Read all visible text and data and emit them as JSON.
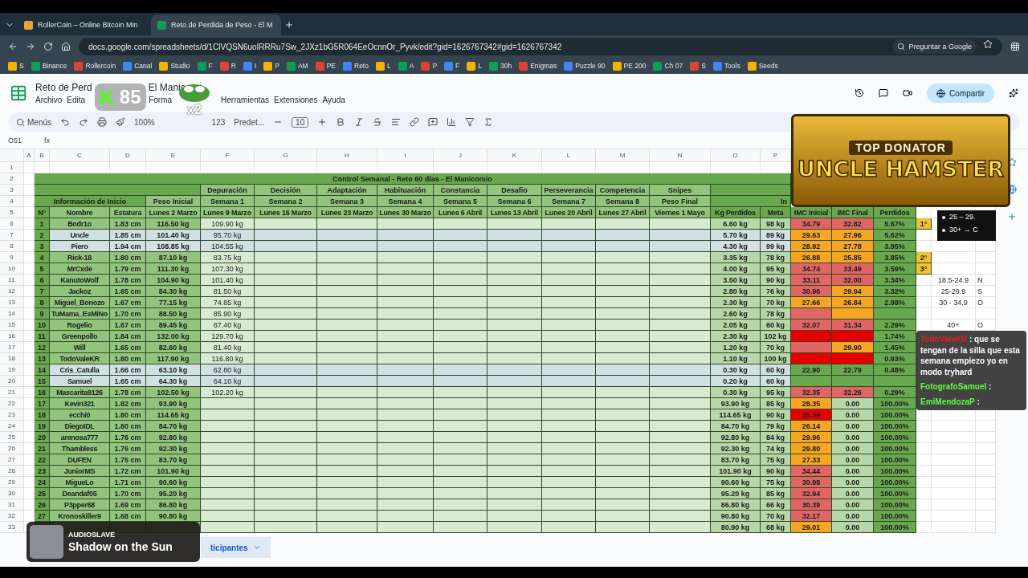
{
  "browser": {
    "tabs": [
      {
        "label": "RollerCoin – Online Bitcoin Min",
        "selected": false
      },
      {
        "label": "Reto de Perdida de Peso - El M",
        "selected": true
      }
    ],
    "url": "docs.google.com/spreadsheets/d/1ClVQSN6uoIRRRu7Sw_2JXz1bG5R064EeOcnnOr_Pyvk/edit?gid=1626767342#gid=1626767342",
    "ask_button": "Preguntar a Google",
    "bookmarks": [
      "S",
      "Binance",
      "Rollercoin",
      "Canal",
      "Studio",
      "F",
      "R",
      "I",
      "P",
      "AM",
      "PE",
      "Reto",
      "L",
      "A",
      "P",
      "F",
      "L",
      "30h",
      "Enigmas",
      "Puzzle 90",
      "PE 200",
      "Ch 07",
      "S",
      "Tools",
      "Seeds"
    ]
  },
  "sheets": {
    "title": "Reto de Perd",
    "title_tail": "El Manic",
    "menus": [
      "Archivo",
      "Edita",
      "Forma",
      "Herramientas",
      "Extensiones",
      "Ayuda"
    ],
    "share_button": "Compartir",
    "search_menus": "Menús",
    "zoom": "100%",
    "number_format": "123",
    "font": "Predet...",
    "font_size": "10",
    "cell_ref": "O51",
    "formula_label": "fx"
  },
  "row_numbers": [
    "1",
    "2",
    "3",
    "4",
    "5",
    "6",
    "7",
    "8",
    "9",
    "10",
    "11",
    "12",
    "13",
    "14",
    "15",
    "16",
    "17",
    "18",
    "19",
    "20",
    "21",
    "22",
    "23",
    "24",
    "25",
    "26",
    "27",
    "28",
    "29",
    "30",
    "31",
    "32",
    "33"
  ],
  "column_letters": [
    "A",
    "B",
    "C",
    "D",
    "E",
    "F",
    "G",
    "H",
    "I",
    "J",
    "K",
    "L",
    "M",
    "N",
    "O",
    "P"
  ],
  "table_title": "Control Semanal - Reto 60 días - El Manicomio",
  "stages": [
    "Depuración",
    "Decisión",
    "Adaptación",
    "Habituación",
    "Constancia",
    "Desafio",
    "Perseverancia",
    "Competencia",
    "Snipes"
  ],
  "group_start": "Información de Inicio",
  "peso_inicial": "Peso Inicial",
  "weeks": [
    "Semana 1",
    "Semana 2",
    "Semana 3",
    "Semana 4",
    "Semana 5",
    "Semana 6",
    "Semana 7",
    "Semana 8",
    "Peso Final"
  ],
  "group_end": "In",
  "columns": [
    "N°",
    "Nombre",
    "Estatura",
    "Lunes 2 Marzo",
    "Lunes 9 Marzo",
    "Lunes 16 Marzo",
    "Lunes 23 Marzo",
    "Lunes 30 Marzo",
    "Lunes 6 Abril",
    "Lunes 13 Abril",
    "Lunes 20 Abril",
    "Lunes 27 Abril",
    "Viernes 1 Mayo",
    "Kg Perdidos",
    "Meta",
    "IMC Inicial",
    "IMC Final",
    "Perdidos"
  ],
  "rows": [
    {
      "n": "1",
      "name": "Bodr1o",
      "height": "1.83 cm",
      "start": "116.50 kg",
      "week1": "109.90 kg",
      "lost": "6.60 kg",
      "goal": "98 kg",
      "imc_start": {
        "value": "34.79",
        "color": "#e06666"
      },
      "imc_end": {
        "value": "32.82",
        "color": "#e06666"
      },
      "percent": "5.67%",
      "rank": "1°",
      "highlighted": false
    },
    {
      "n": "2",
      "name": "Uncle",
      "height": "1.85 cm",
      "start": "101.40 kg",
      "week1": "95.70 kg",
      "lost": "5.70 kg",
      "goal": "89 kg",
      "imc_start": {
        "value": "29.63",
        "color": "#f6a623"
      },
      "imc_end": {
        "value": "27.96",
        "color": "#f6a623"
      },
      "percent": "5.62%",
      "highlighted": true
    },
    {
      "n": "3",
      "name": "Piero",
      "height": "1.94 cm",
      "start": "108.85 kg",
      "week1": "104.55 kg",
      "lost": "4.30 kg",
      "goal": "99 kg",
      "imc_start": {
        "value": "28.92",
        "color": "#f6a623"
      },
      "imc_end": {
        "value": "27.78",
        "color": "#f6a623"
      },
      "percent": "3.95%",
      "highlighted": true
    },
    {
      "n": "4",
      "name": "Rick-18",
      "height": "1.80 cm",
      "start": "87.10 kg",
      "week1": "83.75 kg",
      "lost": "3.35 kg",
      "goal": "78 kg",
      "imc_start": {
        "value": "26.88",
        "color": "#f6a623"
      },
      "imc_end": {
        "value": "25.85",
        "color": "#f6a623"
      },
      "percent": "3.85%",
      "rank": "2°",
      "highlighted": false
    },
    {
      "n": "5",
      "name": "MrCxde",
      "height": "1.79 cm",
      "start": "111.30 kg",
      "week1": "107.30 kg",
      "lost": "4.00 kg",
      "goal": "95 kg",
      "imc_start": {
        "value": "34.74",
        "color": "#e06666"
      },
      "imc_end": {
        "value": "33.49",
        "color": "#e06666"
      },
      "percent": "3.59%",
      "rank": "3°",
      "highlighted": false
    },
    {
      "n": "6",
      "name": "KanutoWolf",
      "height": "1.78 cm",
      "start": "104.90 kg",
      "week1": "101.40 kg",
      "lost": "3.50 kg",
      "goal": "90 kg",
      "imc_start": {
        "value": "33.11",
        "color": "#e06666"
      },
      "imc_end": {
        "value": "32.00",
        "color": "#e06666"
      },
      "percent": "3.34%",
      "side_range": "18.5-24.9",
      "side_label": "N",
      "highlighted": false
    },
    {
      "n": "7",
      "name": "Jackoz",
      "height": "1.65 cm",
      "start": "84.30 kg",
      "week1": "81.50 kg",
      "lost": "2.80 kg",
      "goal": "76 kg",
      "imc_start": {
        "value": "30.96",
        "color": "#e06666"
      },
      "imc_end": {
        "value": "29.94",
        "color": "#f6a623"
      },
      "percent": "3.32%",
      "side_range": "25-29.9",
      "side_label": "S",
      "highlighted": false
    },
    {
      "n": "8",
      "name": "Miguel_Bonozo",
      "height": "1.67 cm",
      "start": "77.15 kg",
      "week1": "74.85 kg",
      "lost": "2.30 kg",
      "goal": "70 kg",
      "imc_start": {
        "value": "27.66",
        "color": "#f6a623"
      },
      "imc_end": {
        "value": "26.84",
        "color": "#f6a623"
      },
      "percent": "2.98%",
      "side_range": "30 - 34.9",
      "side_label": "O",
      "highlighted": false
    },
    {
      "n": "9",
      "name": "TuMama_EsMiNo",
      "height": "1.70 cm",
      "start": "88.50 kg",
      "week1": "85.90 kg",
      "lost": "2.60 kg",
      "goal": "78 kg",
      "imc_start": {
        "color": "#e06666"
      },
      "imc_end": {
        "color": "#f6a623"
      },
      "highlighted": false
    },
    {
      "n": "10",
      "name": "Rogelio",
      "height": "1.67 cm",
      "start": "89.45 kg",
      "week1": "87.40 kg",
      "lost": "2.05 kg",
      "goal": "60 kg",
      "imc_start": {
        "value": "32.07",
        "color": "#e06666"
      },
      "imc_end": {
        "value": "31.34",
        "color": "#e06666"
      },
      "percent": "2.29%",
      "side_range": "40+",
      "side_label": "O",
      "highlighted": false
    },
    {
      "n": "11",
      "name": "Greenpollo",
      "height": "1.84 cm",
      "start": "132.00 kg",
      "week1": "129.70 kg",
      "lost": "2.30 kg",
      "goal": "102 kg",
      "imc_start": {
        "color": "#e60000"
      },
      "imc_end": {
        "color": "#e60000"
      },
      "percent": "1.74%",
      "highlighted": false
    },
    {
      "n": "12",
      "name": "Will",
      "height": "1.65 cm",
      "start": "82.60 kg",
      "week1": "81.40 kg",
      "lost": "1.20 kg",
      "goal": "70 kg",
      "imc_start": {
        "color": "#e06666"
      },
      "imc_end": {
        "value": "29.90",
        "color": "#f6a623"
      },
      "percent": "1.45%",
      "highlighted": false
    },
    {
      "n": "13",
      "name": "TodoValeKR",
      "height": "1.80 cm",
      "start": "117.90 kg",
      "week1": "116.80 kg",
      "lost": "1.10 kg",
      "goal": "100 kg",
      "imc_start": {
        "color": "#e60000"
      },
      "imc_end": {
        "color": "#e60000"
      },
      "percent": "0.93%",
      "highlighted": false
    },
    {
      "n": "14",
      "name": "Cris_Catulla",
      "height": "1.66 cm",
      "start": "63.10 kg",
      "week1": "62.80 kg",
      "lost": "0.30 kg",
      "goal": "60 kg",
      "imc_start": {
        "value": "22.90",
        "color": "#6aa84f"
      },
      "imc_end": {
        "value": "22.79",
        "color": "#6aa84f"
      },
      "percent": "0.48%",
      "highlighted": true
    },
    {
      "n": "15",
      "name": "Samuel",
      "height": "1.65 cm",
      "start": "64.30 kg",
      "week1": "64.10 kg",
      "lost": "0.20 kg",
      "goal": "60 kg",
      "imc_start": {
        "color": "#6aa84f"
      },
      "imc_end": {
        "color": "#6aa84f"
      },
      "highlighted": true
    },
    {
      "n": "16",
      "name": "Mascarita9126",
      "height": "1.78 cm",
      "start": "102.50 kg",
      "week1": "102.20 kg",
      "lost": "0.30 kg",
      "goal": "95 kg",
      "imc_start": {
        "value": "32.35",
        "color": "#e06666"
      },
      "imc_end": {
        "value": "32.26",
        "color": "#e06666"
      },
      "percent": "0.29%",
      "highlighted": false
    },
    {
      "n": "17",
      "name": "Kevin321",
      "height": "1.82 cm",
      "start": "93.90 kg",
      "lost": "93.90 kg",
      "goal": "85 kg",
      "imc_start": {
        "value": "28.35",
        "color": "#f6a623"
      },
      "imc_end": {
        "value": "0.00",
        "color": "#b6d7a8"
      },
      "percent": "100.00%",
      "highlighted": false
    },
    {
      "n": "18",
      "name": "ecchi0",
      "height": "1.80 cm",
      "start": "114.65 kg",
      "lost": "114.65 kg",
      "goal": "90 kg",
      "imc_start": {
        "value": "35.39",
        "color": "#e60000"
      },
      "imc_end": {
        "value": "0.00",
        "color": "#b6d7a8"
      },
      "percent": "100.00%",
      "highlighted": false
    },
    {
      "n": "19",
      "name": "DiegoIDL",
      "height": "1.80 cm",
      "start": "84.70 kg",
      "lost": "84.70 kg",
      "goal": "79 kg",
      "imc_start": {
        "value": "26.14",
        "color": "#f6a623"
      },
      "imc_end": {
        "value": "0.00",
        "color": "#b6d7a8"
      },
      "percent": "100.00%",
      "highlighted": false
    },
    {
      "n": "20",
      "name": "arenosa777",
      "height": "1.76 cm",
      "start": "92.80 kg",
      "lost": "92.80 kg",
      "goal": "84 kg",
      "imc_start": {
        "value": "29.96",
        "color": "#f6a623"
      },
      "imc_end": {
        "value": "0.00",
        "color": "#b6d7a8"
      },
      "percent": "100.00%",
      "highlighted": false
    },
    {
      "n": "21",
      "name": "Thambless",
      "height": "1.76 cm",
      "start": "92.30 kg",
      "lost": "92.30 kg",
      "goal": "74 kg",
      "imc_start": {
        "value": "29.80",
        "color": "#f6a623"
      },
      "imc_end": {
        "value": "0.00",
        "color": "#b6d7a8"
      },
      "percent": "100.00%",
      "highlighted": false
    },
    {
      "n": "22",
      "name": "DUFEN",
      "height": "1.75 cm",
      "start": "83.70 kg",
      "lost": "83.70 kg",
      "goal": "75 kg",
      "imc_start": {
        "value": "27.33",
        "color": "#f6a623"
      },
      "imc_end": {
        "value": "0.00",
        "color": "#b6d7a8"
      },
      "percent": "100.00%",
      "highlighted": false
    },
    {
      "n": "23",
      "name": "JuniorMS",
      "height": "1.72 cm",
      "start": "101.90 kg",
      "lost": "101.90 kg",
      "goal": "90 kg",
      "imc_start": {
        "value": "34.44",
        "color": "#e06666"
      },
      "imc_end": {
        "value": "0.00",
        "color": "#b6d7a8"
      },
      "percent": "100.00%",
      "highlighted": false
    },
    {
      "n": "24",
      "name": "MigueLo",
      "height": "1.71 cm",
      "start": "90.60 kg",
      "lost": "90.60 kg",
      "goal": "75 kg",
      "imc_start": {
        "value": "30.98",
        "color": "#e06666"
      },
      "imc_end": {
        "value": "0.00",
        "color": "#b6d7a8"
      },
      "percent": "100.00%",
      "highlighted": false
    },
    {
      "n": "25",
      "name": "Deandaf05",
      "height": "1.70 cm",
      "start": "95.20 kg",
      "lost": "95.20 kg",
      "goal": "85 kg",
      "imc_start": {
        "value": "32.94",
        "color": "#e06666"
      },
      "imc_end": {
        "value": "0.00",
        "color": "#b6d7a8"
      },
      "percent": "100.00%",
      "highlighted": false
    },
    {
      "n": "26",
      "name": "P3pper68",
      "height": "1.69 cm",
      "start": "86.80 kg",
      "lost": "86.80 kg",
      "goal": "66 kg",
      "imc_start": {
        "value": "30.39",
        "color": "#e06666"
      },
      "imc_end": {
        "value": "0.00",
        "color": "#b6d7a8"
      },
      "percent": "100.00%",
      "highlighted": false
    },
    {
      "n": "27",
      "name": "Kronoskiller9",
      "height": "1.68 cm",
      "start": "90.80 kg",
      "lost": "90.80 kg",
      "goal": "70 kg",
      "imc_start": {
        "value": "32.17",
        "color": "#e06666"
      },
      "imc_end": {
        "value": "0.00",
        "color": "#b6d7a8"
      },
      "percent": "100.00%",
      "highlighted": false
    },
    {
      "lost": "80.90 kg",
      "goal": "68 kg",
      "imc_start": {
        "value": "29.01",
        "color": "#f6a623"
      },
      "imc_end": {
        "value": "0.00",
        "color": "#b6d7a8"
      },
      "percent": "100.00%"
    }
  ],
  "legend_box": [
    "25 – 29.",
    "30+ → C"
  ],
  "sheet_tab": "ticipantes",
  "overlays": {
    "emote_letter": "K",
    "emote_count": "85",
    "emote_multiplier": "x2",
    "banner_top": "TOP DONATOR",
    "banner_name": "UNCLE HAMSTER",
    "chat": [
      {
        "user": "TodoValeKR",
        "separator": ":",
        "message": "que se tengan de la silla que esta semana empiezo yo en modo tryhard",
        "color": "#e02020"
      },
      {
        "user": "FotografoSamuel",
        "separator": ":",
        "color": "#5cff3a"
      },
      {
        "user": "EmiMendozaP",
        "separator": ":",
        "color": "#5cff3a"
      }
    ],
    "music": {
      "artist": "AUDIOSLAVE",
      "song": "Shadow on the Sun"
    }
  }
}
